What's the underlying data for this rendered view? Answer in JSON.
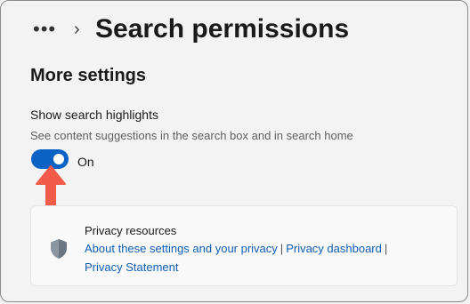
{
  "header": {
    "more_label": "•••",
    "chevron": "›",
    "title": "Search permissions"
  },
  "section": {
    "title": "More settings"
  },
  "search_highlights": {
    "name": "Show search highlights",
    "description": "See content suggestions in the search box and in search home",
    "toggle_state_label": "On",
    "toggle_on": true
  },
  "privacy": {
    "heading": "Privacy resources",
    "links": [
      "About these settings and your privacy",
      "Privacy dashboard",
      "Privacy Statement"
    ],
    "separator": "|"
  },
  "colors": {
    "accent": "#0a63c4",
    "link": "#0e5fb6",
    "annotation_arrow": "#f25a4a"
  },
  "icons": {
    "more": "ellipsis-icon",
    "chevron": "chevron-right-icon",
    "shield": "shield-icon",
    "arrow": "red-annotation-arrow"
  }
}
